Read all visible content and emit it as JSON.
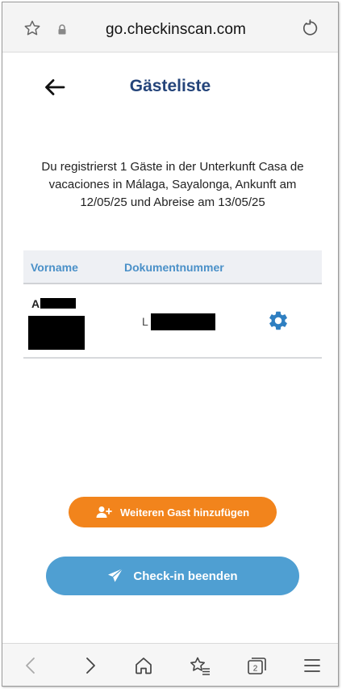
{
  "browser": {
    "url": "go.checkinscan.com"
  },
  "header": {
    "title": "Gästeliste"
  },
  "info_text": "Du registrierst 1 Gäste in der Unterkunft Casa de vacaciones in Málaga, Sayalonga, Ankunft am 12/05/25 und Abreise am 13/05/25",
  "table": {
    "columns": [
      "Vorname",
      "Dokumentnummer"
    ],
    "rows": [
      {
        "first_name_visible": "A",
        "document_visible": "L"
      }
    ]
  },
  "buttons": {
    "add_guest": "Weiteren Gast hinzufügen",
    "finish_checkin": "Check-in beenden"
  },
  "colors": {
    "title": "#24447a",
    "column_header": "#4a90c8",
    "add_button": "#f2841c",
    "checkin_button": "#4f9fd2",
    "gear": "#2f7fc1"
  },
  "icons": {
    "toolbar": [
      "back-icon",
      "forward-icon",
      "home-icon",
      "bookmarks-icon",
      "tabs-icon",
      "menu-icon"
    ],
    "tabs_count": "2"
  }
}
